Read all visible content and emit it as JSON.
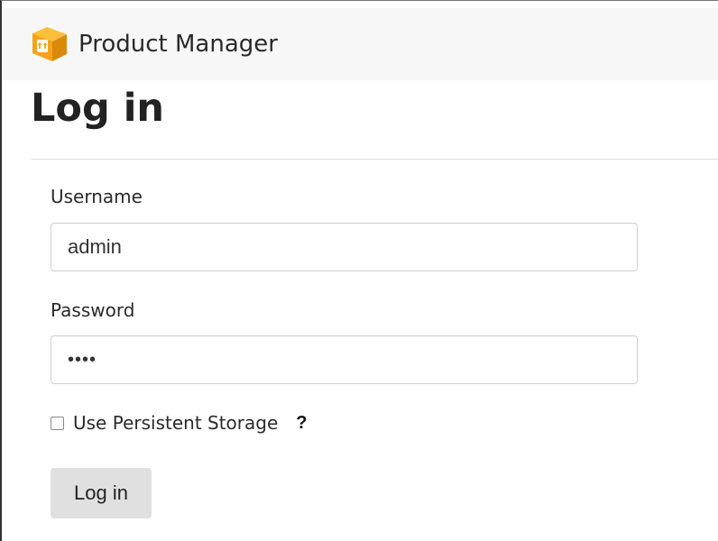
{
  "app": {
    "brand_name": "Product Manager",
    "logo_icon": "package-box-icon",
    "accent_color": "#f5a31a"
  },
  "page": {
    "title": "Log in"
  },
  "form": {
    "username_label": "Username",
    "username_value": "admin",
    "password_label": "Password",
    "password_value": "••••",
    "persistent_storage_label": "Use Persistent Storage",
    "persistent_storage_checked": false,
    "help_icon": "?",
    "submit_label": "Log in"
  }
}
